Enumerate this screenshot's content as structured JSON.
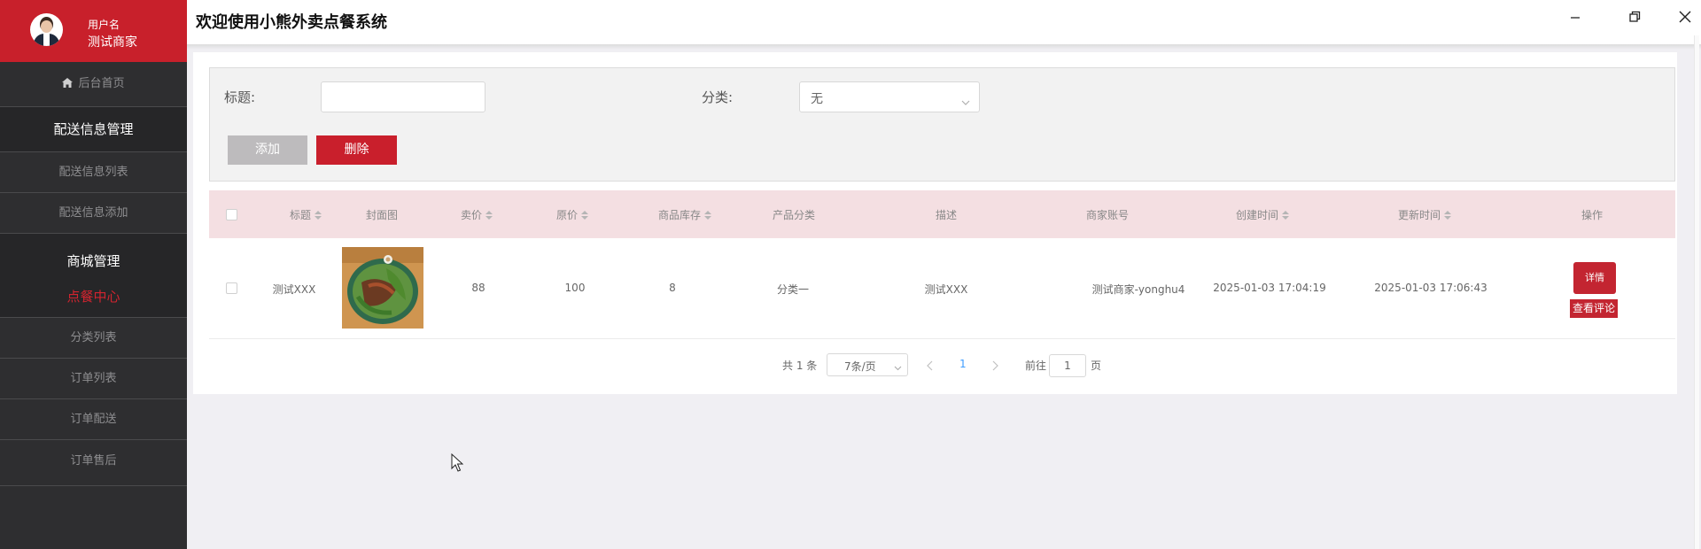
{
  "window": {
    "title": "欢迎使用小熊外卖点餐系统",
    "controls": [
      "minimize-icon",
      "restore-icon",
      "close-icon"
    ]
  },
  "user": {
    "username_label": "用户名",
    "shop_name": "测试商家"
  },
  "sidebar": {
    "home": "后台首页",
    "delivery_group": "配送信息管理",
    "delivery_list": "配送信息列表",
    "delivery_add": "配送信息添加",
    "mall_group": "商城管理",
    "dishes": "点餐中心",
    "category_list": "分类列表",
    "order_list": "订单列表",
    "order_delivery": "订单配送",
    "order_aftersale": "订单售后"
  },
  "search": {
    "title_label": "标题:",
    "title_value": "",
    "category_label": "分类:",
    "category_value": "无",
    "add_button": "添加",
    "delete_button": "删除"
  },
  "table": {
    "columns": [
      "标题",
      "封面图",
      "卖价",
      "原价",
      "商品库存",
      "产品分类",
      "描述",
      "商家账号",
      "创建时间",
      "更新时间",
      "操作"
    ],
    "rows": [
      {
        "title": "测试XXX",
        "price": "88",
        "original_price": "100",
        "stock": "8",
        "category": "分类一",
        "description": "测试XXX",
        "merchant": "测试商家-yonghu4",
        "created": "2025-01-03 17:04:19",
        "updated": "2025-01-03 17:06:43",
        "detail_button": "详情",
        "review_button": "查看评论"
      }
    ]
  },
  "pagination": {
    "total": "共 1 条",
    "page_size": "7条/页",
    "current_page": "1",
    "goto_label": "前往",
    "goto_value": "1",
    "page_suffix": "页"
  },
  "colors": {
    "brand_red": "#c8202b",
    "sidebar_bg": "#2e2e30",
    "table_header_bg": "#f4dfe2"
  }
}
